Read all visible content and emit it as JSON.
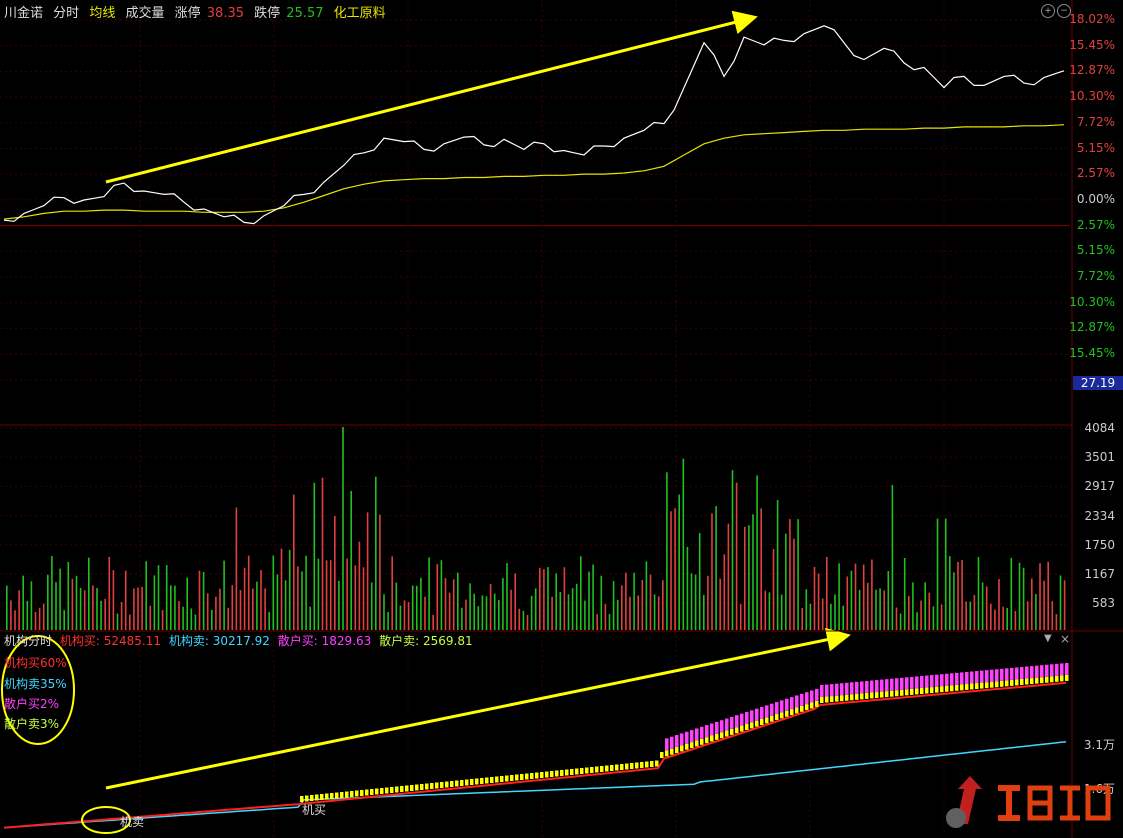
{
  "header": {
    "stock_name": "川金诺",
    "view_label": "分时",
    "avg_label": "均线",
    "volume_label": "成交量",
    "limit_up_label": "涨停",
    "limit_up_value": "38.35",
    "limit_down_label": "跌停",
    "limit_down_value": "25.57",
    "sector": "化工原料"
  },
  "price_axis": [
    "18.02%",
    "15.45%",
    "12.87%",
    "10.30%",
    "7.72%",
    "5.15%",
    "2.57%",
    "0.00%",
    "2.57%",
    "5.15%",
    "7.72%",
    "10.30%",
    "12.87%",
    "15.45%"
  ],
  "current_price": "27.19",
  "volume_axis": [
    "4084",
    "3501",
    "2917",
    "2334",
    "1750",
    "1167",
    "583"
  ],
  "indicator": {
    "name": "机构分时",
    "inst_buy_label": "机构买:",
    "inst_buy_value": "52485.11",
    "inst_sell_label": "机构卖:",
    "inst_sell_value": "30217.92",
    "retail_buy_label": "散户买:",
    "retail_buy_value": "1829.63",
    "retail_sell_label": "散户卖:",
    "retail_sell_value": "2569.81",
    "legend": [
      "机构买60%",
      "机构卖35%",
      "散户买2%",
      "散户卖3%"
    ],
    "axis": [
      "3.1万",
      "1.6万"
    ],
    "markers": [
      "机买",
      "机卖"
    ]
  },
  "colors": {
    "price_line": "#ffffff",
    "avg_line": "#e6e600",
    "up": "#e04040",
    "down": "#20c020",
    "inst_buy": "#ff2020",
    "inst_sell": "#40d8ff",
    "retail_buy": "#ff40ff",
    "retail_sell": "#ffff00",
    "annotation": "#ffff00",
    "grid": "#3a0000"
  },
  "chart_data": {
    "type": "line",
    "series": [
      {
        "name": "",
        "values": [
          0.2,
          0.8,
          1.5,
          2.2,
          2.0,
          2.3,
          3.5,
          2.8,
          2.5,
          1.8,
          1.2,
          0.5,
          0.0,
          0.6,
          1.5,
          2.5,
          3.6,
          5.1,
          6.2,
          7.5,
          7.2,
          6.5,
          7.0,
          7.6,
          6.9,
          7.4,
          6.5,
          7.0,
          6.4,
          6.0,
          6.8,
          7.5,
          8.2,
          8.8,
          12.0,
          16.0,
          13.0,
          16.5,
          15.8,
          16.2,
          16.8,
          17.5,
          16.0,
          14.5,
          15.5,
          14.2,
          13.8,
          12.0,
          13.0,
          12.2,
          13.0,
          12.4,
          12.9,
          13.5
        ]
      },
      {
        "name": "",
        "values": [
          0.3,
          0.5,
          0.8,
          1.0,
          1.0,
          1.1,
          1.1,
          1.0,
          1.0,
          1.0,
          0.9,
          0.9,
          0.9,
          1.0,
          1.3,
          1.8,
          2.4,
          3.0,
          3.4,
          3.7,
          3.8,
          3.9,
          3.9,
          4.0,
          4.0,
          4.1,
          4.1,
          4.2,
          4.2,
          4.3,
          4.3,
          4.4,
          4.6,
          5.0,
          6.0,
          7.0,
          7.5,
          7.8,
          7.9,
          8.0,
          8.1,
          8.2,
          8.2,
          8.3,
          8.3,
          8.3,
          8.4,
          8.4,
          8.5,
          8.5,
          8.5,
          8.6,
          8.6,
          8.7
        ]
      }
    ],
    "ylim": [
      -15.45,
      18.02
    ]
  }
}
